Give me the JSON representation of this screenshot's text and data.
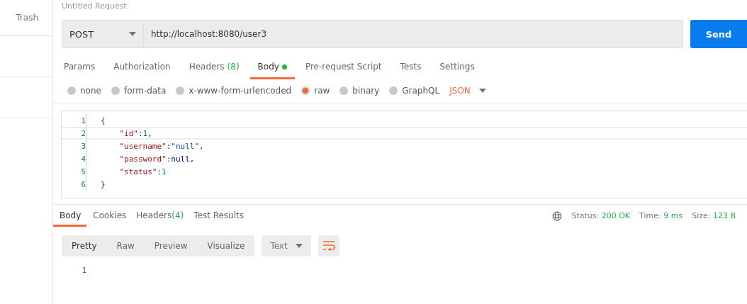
{
  "sidebar": {
    "items": [
      {
        "label": "Trash"
      }
    ]
  },
  "title": "Untitled Request",
  "request": {
    "method": "POST",
    "url": "http://localhost:8080/user3",
    "send": "Send"
  },
  "tabs": [
    {
      "label": "Params",
      "selected": false
    },
    {
      "label": "Authorization",
      "selected": false
    },
    {
      "label": "Headers",
      "count": "(8)",
      "selected": false
    },
    {
      "label": "Body",
      "dot": true,
      "selected": true
    },
    {
      "label": "Pre-request Script",
      "selected": false
    },
    {
      "label": "Tests",
      "selected": false
    },
    {
      "label": "Settings",
      "selected": false
    }
  ],
  "body_types": [
    {
      "label": "none",
      "selected": false
    },
    {
      "label": "form-data",
      "selected": false
    },
    {
      "label": "x-www-form-urlencoded",
      "selected": false
    },
    {
      "label": "raw",
      "selected": true
    },
    {
      "label": "binary",
      "selected": false
    },
    {
      "label": "GraphQL",
      "selected": false
    }
  ],
  "format": "JSON",
  "editor": {
    "lines": [
      {
        "number": "1",
        "tokens": [
          {
            "kind": "punct",
            "text": "{"
          }
        ]
      },
      {
        "number": "2",
        "tokens": [
          {
            "kind": "key",
            "text": "    \"id\""
          },
          {
            "kind": "punct",
            "text": ":"
          },
          {
            "kind": "number",
            "text": "1"
          },
          {
            "kind": "punct",
            "text": ","
          }
        ]
      },
      {
        "number": "3",
        "tokens": [
          {
            "kind": "key",
            "text": "    \"username\""
          },
          {
            "kind": "punct",
            "text": ":"
          },
          {
            "kind": "string",
            "text": "\"null\""
          },
          {
            "kind": "punct",
            "text": ","
          }
        ]
      },
      {
        "number": "4",
        "tokens": [
          {
            "kind": "key",
            "text": "    \"password\""
          },
          {
            "kind": "punct",
            "text": ":"
          },
          {
            "kind": "keyword",
            "text": "null"
          },
          {
            "kind": "punct",
            "text": ","
          }
        ]
      },
      {
        "number": "5",
        "tokens": [
          {
            "kind": "key",
            "text": "    \"status\""
          },
          {
            "kind": "punct",
            "text": ":"
          },
          {
            "kind": "number",
            "text": "1"
          }
        ]
      },
      {
        "number": "6",
        "tokens": [
          {
            "kind": "punct",
            "text": "}"
          }
        ]
      }
    ]
  },
  "response_tabs": [
    {
      "label": "Body",
      "selected": true
    },
    {
      "label": "Cookies",
      "selected": false
    },
    {
      "label": "Headers",
      "count": "(4)",
      "selected": false
    },
    {
      "label": "Test Results",
      "selected": false
    }
  ],
  "stats": [
    {
      "label": "Status:",
      "value": "200 OK"
    },
    {
      "label": "Time:",
      "value": "9 ms"
    },
    {
      "label": "Size:",
      "value": "123 B"
    }
  ],
  "view_modes": [
    {
      "label": "Pretty",
      "selected": true
    },
    {
      "label": "Raw",
      "selected": false
    },
    {
      "label": "Preview",
      "selected": false
    },
    {
      "label": "Visualize",
      "selected": false
    }
  ],
  "response_format": "Text",
  "response_lines": [
    "1"
  ]
}
